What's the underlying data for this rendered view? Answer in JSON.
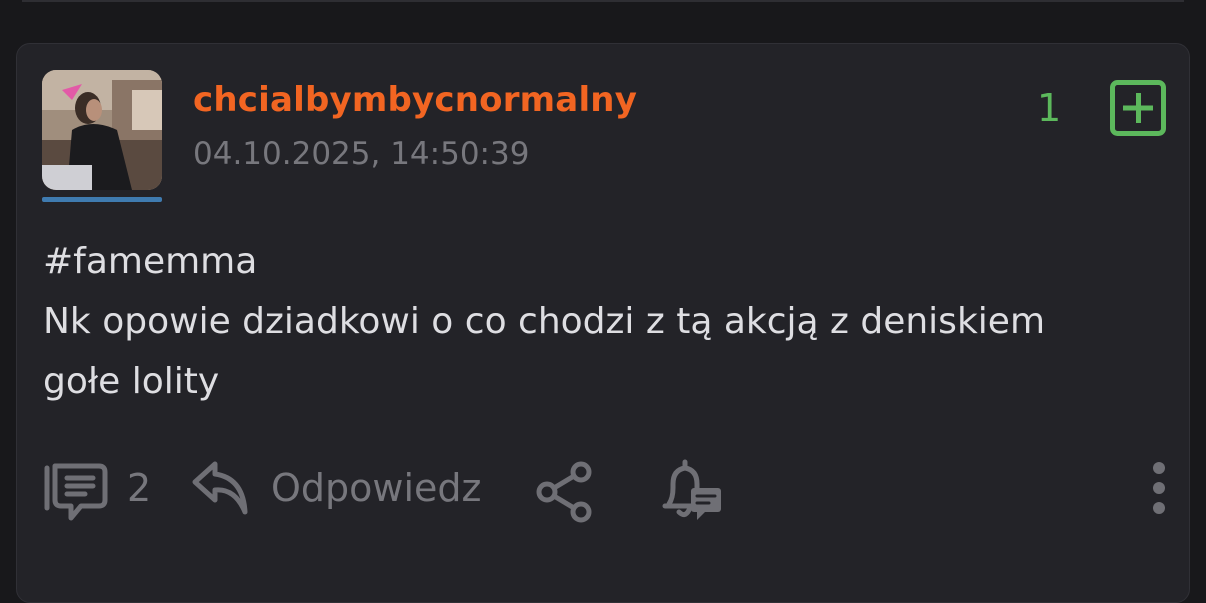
{
  "post": {
    "author": {
      "username": "chcialbymbycnormalny",
      "username_color": "#f26522"
    },
    "timestamp": "04.10.2025, 14:50:39",
    "votes": {
      "count": "1",
      "color": "#5cb85c"
    },
    "content": {
      "tag": "#famemma",
      "lines": [
        "Nk opowie dziadkowi o co chodzi z tą akcją z deniskiem",
        "gołe lolity"
      ]
    },
    "actions": {
      "comments_icon": "comment-icon",
      "comments_count": "2",
      "reply_icon": "reply-icon",
      "reply_label": "Odpowiedz",
      "share_icon": "share-icon",
      "notify_icon": "bell-notification-icon",
      "more_icon": "more-vertical-icon"
    }
  }
}
